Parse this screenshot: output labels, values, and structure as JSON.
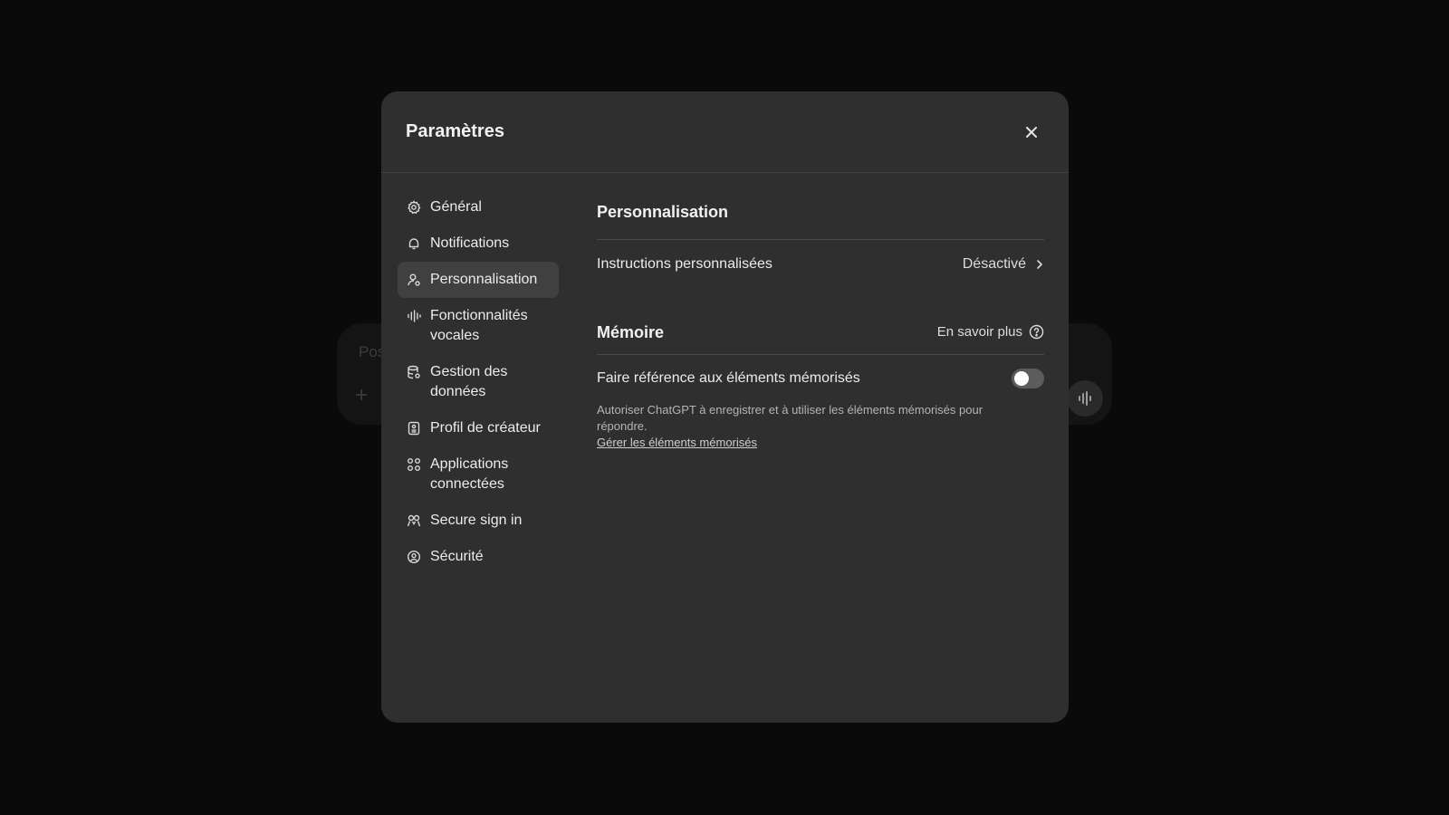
{
  "background": {
    "composer_placeholder": "Pos",
    "plus_symbol": "+",
    "voice_icon": "waveform-icon"
  },
  "modal": {
    "title": "Paramètres",
    "close_icon": "close-icon"
  },
  "sidebar": {
    "items": [
      {
        "label": "Général",
        "icon": "gear-icon",
        "active": false
      },
      {
        "label": "Notifications",
        "icon": "bell-icon",
        "active": false
      },
      {
        "label": "Personnalisation",
        "icon": "person-gear-icon",
        "active": true
      },
      {
        "label": "Fonctionnalités vocales",
        "icon": "waveform-icon",
        "active": false
      },
      {
        "label": "Gestion des données",
        "icon": "database-gear-icon",
        "active": false
      },
      {
        "label": "Profil de créateur",
        "icon": "id-card-icon",
        "active": false
      },
      {
        "label": "Applications connectées",
        "icon": "apps-grid-icon",
        "active": false
      },
      {
        "label": "Secure sign in",
        "icon": "people-icon",
        "active": false
      },
      {
        "label": "Sécurité",
        "icon": "shield-user-icon",
        "active": false
      }
    ]
  },
  "content": {
    "section_title": "Personnalisation",
    "custom_instructions": {
      "label": "Instructions personnalisées",
      "status": "Désactivé"
    },
    "memory": {
      "title": "Mémoire",
      "learn_more": "En savoir plus",
      "reference_label": "Faire référence aux éléments mémorisés",
      "toggle_on": false,
      "description": "Autoriser ChatGPT à enregistrer et à utiliser les éléments mémorisés pour répondre.",
      "manage_link": "Gérer les éléments mémorisés"
    }
  },
  "colors": {
    "page_bg": "#0a0a0a",
    "modal_bg": "#2f2f2f",
    "active_item_bg": "#404040",
    "toggle_off": "#5c5c5c"
  }
}
